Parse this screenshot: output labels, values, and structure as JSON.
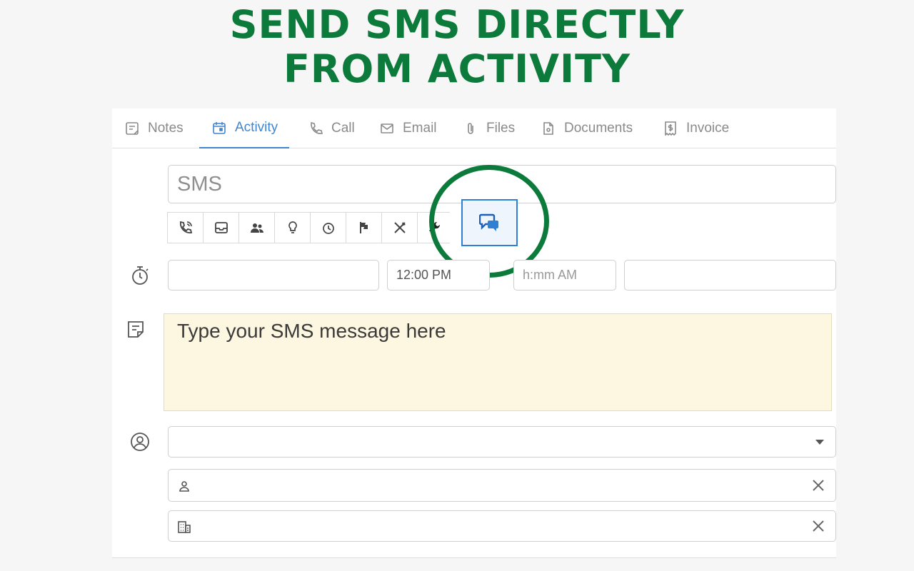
{
  "headline": {
    "line1": "SEND SMS DIRECTLY",
    "line2": "FROM ACTIVITY"
  },
  "tabs": [
    {
      "label": "Notes",
      "icon": "notes-icon",
      "active": false
    },
    {
      "label": "Activity",
      "icon": "calendar-icon",
      "active": true
    },
    {
      "label": "Call",
      "icon": "phone-icon",
      "active": false
    },
    {
      "label": "Email",
      "icon": "envelope-icon",
      "active": false
    },
    {
      "label": "Files",
      "icon": "paperclip-icon",
      "active": false
    },
    {
      "label": "Documents",
      "icon": "document-icon",
      "active": false
    },
    {
      "label": "Invoice",
      "icon": "invoice-icon",
      "active": false
    }
  ],
  "activity": {
    "subject_value": "SMS",
    "activity_types": [
      "phone-call-icon",
      "inbox-icon",
      "meeting-icon",
      "lightbulb-icon",
      "clock-icon",
      "flag-icon",
      "lunch-icon",
      "wrench-icon",
      "sms-chat-icon"
    ],
    "selected_type": "sms-chat-icon",
    "start_date_value": "",
    "start_time_value": "12:00 PM",
    "end_time_placeholder": "h:mm AM",
    "end_date_value": "",
    "message_placeholder": "Type your SMS message here",
    "assignee_value": "",
    "contact_value": "",
    "company_value": ""
  },
  "colors": {
    "headline_green": "#0c7a3a",
    "active_tab_blue": "#3f86cf",
    "sms_button_border": "#2f7fd4",
    "message_bg": "#fdf6e1"
  }
}
